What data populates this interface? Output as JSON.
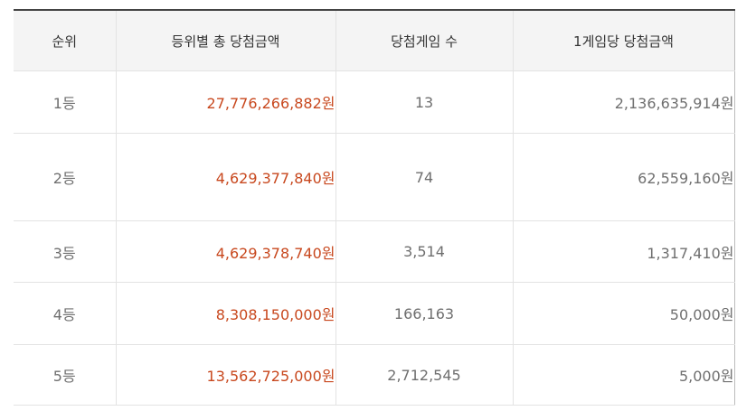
{
  "table": {
    "headers": [
      "순위",
      "등위별 총 당첨금액",
      "당첨게임 수",
      "1게임당 당첨금액"
    ],
    "rows": [
      {
        "rank": "1등",
        "total": "27,776,266,882원",
        "winners": "13",
        "per_game": "2,136,635,914원"
      },
      {
        "rank": "2등",
        "total": "4,629,377,840원",
        "winners": "74",
        "per_game": "62,559,160원"
      },
      {
        "rank": "3등",
        "total": "4,629,378,740원",
        "winners": "3,514",
        "per_game": "1,317,410원"
      },
      {
        "rank": "4등",
        "total": "8,308,150,000원",
        "winners": "166,163",
        "per_game": "50,000원"
      },
      {
        "rank": "5등",
        "total": "13,562,725,000원",
        "winners": "2,712,545",
        "per_game": "5,000원"
      }
    ]
  },
  "colors": {
    "amount_accent": "#c8481e",
    "header_bg": "#f4f4f4",
    "top_border": "#444444"
  }
}
